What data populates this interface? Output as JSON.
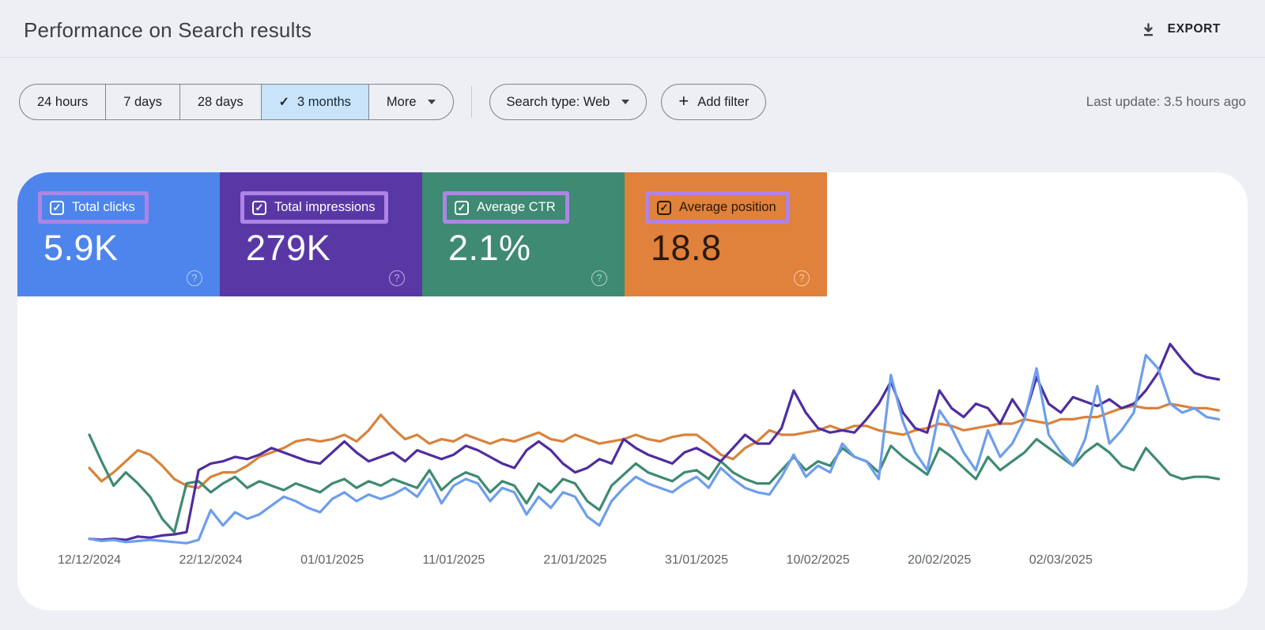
{
  "header": {
    "title": "Performance on Search results",
    "export_label": "EXPORT"
  },
  "toolbar": {
    "date_ranges": [
      {
        "label": "24 hours",
        "selected": false,
        "dropdown": false
      },
      {
        "label": "7 days",
        "selected": false,
        "dropdown": false
      },
      {
        "label": "28 days",
        "selected": false,
        "dropdown": false
      },
      {
        "label": "3 months",
        "selected": true,
        "dropdown": false
      },
      {
        "label": "More",
        "selected": false,
        "dropdown": true
      }
    ],
    "search_type": {
      "label": "Search type: Web"
    },
    "add_filter": {
      "label": "Add filter"
    },
    "last_update": "Last update: 3.5 hours ago"
  },
  "icons": {
    "check": "✓",
    "plus": "+",
    "question": "?"
  },
  "highlight_color": "#ae84e4",
  "cards": [
    {
      "label": "Total clicks",
      "value": "5.9K",
      "bg": "#4d85ec",
      "fg": "#ffffff",
      "checked": true
    },
    {
      "label": "Total impressions",
      "value": "279K",
      "bg": "#5938a6",
      "fg": "#ffffff",
      "checked": true
    },
    {
      "label": "Average CTR",
      "value": "2.1%",
      "bg": "#3e8a73",
      "fg": "#ffffff",
      "checked": true
    },
    {
      "label": "Average position",
      "value": "18.8",
      "bg": "#e0813c",
      "fg": "#2b1a07",
      "checked": true
    }
  ],
  "chart_data": {
    "type": "line",
    "title": "",
    "xlabel": "",
    "ylabel": "",
    "grid": false,
    "y_axis_visible": false,
    "units": "relative_0_100_of_plot_height",
    "x_labels": [
      "12/12/2024",
      "22/12/2024",
      "01/01/2025",
      "11/01/2025",
      "21/01/2025",
      "31/01/2025",
      "10/02/2025",
      "20/02/2025",
      "02/03/2025"
    ],
    "days_per_tick": 10,
    "series": [
      {
        "name": "Average position",
        "color": "#d9823b",
        "values": [
          35,
          29,
          33,
          38,
          43,
          41,
          36,
          30,
          27,
          26,
          31,
          33,
          33,
          36,
          40,
          42,
          44,
          47,
          48,
          47,
          48,
          50,
          47,
          52,
          59,
          53,
          48,
          50,
          46,
          48,
          47,
          50,
          48,
          46,
          48,
          47,
          49,
          51,
          48,
          47,
          50,
          48,
          46,
          47,
          48,
          50,
          48,
          47,
          49,
          50,
          50,
          46,
          41,
          39,
          44,
          47,
          52,
          50,
          50,
          51,
          52,
          54,
          52,
          54,
          54,
          52,
          51,
          50,
          52,
          53,
          55,
          54,
          52,
          53,
          54,
          55,
          55,
          57,
          56,
          55,
          57,
          57,
          58,
          58,
          60,
          62,
          63,
          62,
          62,
          64,
          63,
          62,
          62,
          61
        ]
      },
      {
        "name": "Average CTR",
        "color": "#3e8a73",
        "values": [
          50,
          38,
          27,
          33,
          28,
          22,
          12,
          6,
          28,
          29,
          24,
          28,
          31,
          26,
          29,
          27,
          25,
          28,
          26,
          24,
          28,
          30,
          26,
          29,
          27,
          30,
          28,
          26,
          34,
          25,
          30,
          33,
          31,
          24,
          29,
          27,
          19,
          28,
          24,
          30,
          28,
          20,
          16,
          27,
          32,
          37,
          33,
          31,
          29,
          33,
          34,
          30,
          38,
          33,
          30,
          28,
          28,
          34,
          40,
          34,
          38,
          36,
          44,
          40,
          38,
          33,
          45,
          40,
          36,
          32,
          44,
          40,
          35,
          30,
          40,
          34,
          38,
          42,
          48,
          44,
          40,
          36,
          42,
          46,
          42,
          36,
          34,
          44,
          38,
          32,
          30,
          31,
          31,
          30
        ]
      },
      {
        "name": "Total impressions",
        "color": "#4f2d9f",
        "values": [
          3,
          2.5,
          3,
          2.5,
          4,
          3.5,
          4.5,
          5,
          6,
          34,
          37,
          38,
          40,
          39,
          41,
          44,
          42,
          40,
          38,
          37,
          42,
          47,
          42,
          38,
          40,
          42,
          38,
          43,
          41,
          39,
          41,
          45,
          43,
          40,
          37,
          35,
          43,
          47,
          43,
          37,
          33,
          35,
          39,
          37,
          48,
          44,
          41,
          39,
          37,
          42,
          44,
          41,
          38,
          44,
          50,
          46,
          46,
          53,
          70,
          60,
          53,
          51,
          52,
          51,
          57,
          64,
          74,
          60,
          53,
          51,
          70,
          62,
          58,
          64,
          62,
          55,
          66,
          58,
          76,
          64,
          60,
          67,
          65,
          63,
          66,
          62,
          64,
          70,
          78,
          91,
          84,
          78,
          76,
          75
        ]
      },
      {
        "name": "Total clicks",
        "color": "#6d9eeb",
        "values": [
          3,
          2,
          2.5,
          1.5,
          2,
          2.5,
          2,
          1.5,
          1,
          2.5,
          16,
          9,
          15,
          12,
          14,
          18,
          22,
          20,
          17,
          15,
          21,
          24,
          20,
          23,
          21,
          23,
          26,
          22,
          30,
          19,
          27,
          30,
          28,
          20,
          26,
          24,
          14,
          22,
          17,
          24,
          22,
          13,
          9,
          20,
          26,
          31,
          28,
          26,
          24,
          28,
          31,
          26,
          35,
          30,
          26,
          24,
          23,
          31,
          41,
          31,
          36,
          33,
          46,
          40,
          38,
          30,
          77,
          56,
          42,
          34,
          61,
          53,
          42,
          34,
          52,
          40,
          46,
          57,
          80,
          50,
          42,
          36,
          48,
          72,
          46,
          52,
          60,
          86,
          80,
          64,
          60,
          62,
          58,
          57
        ]
      }
    ]
  }
}
